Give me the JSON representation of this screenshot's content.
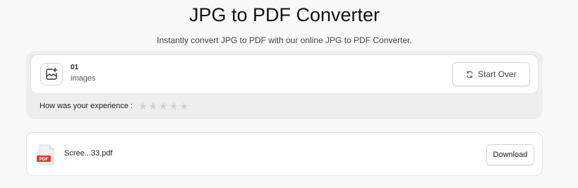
{
  "header": {
    "title": "JPG to PDF Converter",
    "subtitle": "Instantly convert JPG to PDF with our online JPG to PDF Converter."
  },
  "upload": {
    "count": "01",
    "count_label": "images",
    "add_icon": "add-image-icon",
    "start_over_label": "Start Over",
    "start_over_icon": "refresh-icon"
  },
  "feedback": {
    "question": "How was your experience :",
    "rating": 0,
    "max_rating": 5
  },
  "result": {
    "file_icon": "pdf-file-icon",
    "file_badge": "PDF",
    "filename": "Scree...33.pdf",
    "download_label": "Download"
  },
  "colors": {
    "page_bg": "#f8f8f8",
    "panel_bg": "#eeeeee",
    "star_empty": "#cbd0da",
    "pdf_red": "#e53935"
  }
}
